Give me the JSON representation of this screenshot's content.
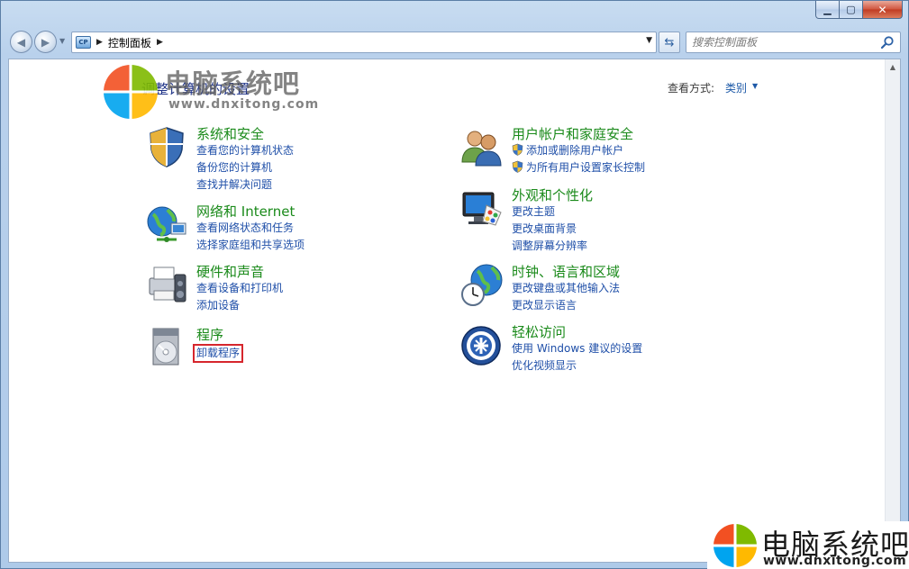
{
  "window": {
    "caption": {
      "minimize": "▁",
      "maximize": "▢",
      "close": "✕"
    }
  },
  "navbar": {
    "address_icon": "CP",
    "address_text": "控制面板",
    "search_placeholder": "搜索控制面板"
  },
  "header": {
    "title": "调整计算机的设置",
    "viewby_label": "查看方式:",
    "viewby_value": "类别"
  },
  "categories": [
    {
      "title": "系统和安全",
      "icon": "shield-icon",
      "links": [
        "查看您的计算机状态",
        "备份您的计算机",
        "查找并解决问题"
      ]
    },
    {
      "title": "网络和 Internet",
      "icon": "network-globe-icon",
      "links": [
        "查看网络状态和任务",
        "选择家庭组和共享选项"
      ]
    },
    {
      "title": "硬件和声音",
      "icon": "printer-speaker-icon",
      "links": [
        "查看设备和打印机",
        "添加设备"
      ]
    },
    {
      "title": "程序",
      "icon": "programs-disc-icon",
      "links": [
        "卸载程序"
      ]
    },
    {
      "title": "用户帐户和家庭安全",
      "icon": "users-icon",
      "links": [
        "添加或删除用户帐户",
        "为所有用户设置家长控制"
      ]
    },
    {
      "title": "外观和个性化",
      "icon": "monitor-palette-icon",
      "links": [
        "更改主题",
        "更改桌面背景",
        "调整屏幕分辨率"
      ]
    },
    {
      "title": "时钟、语言和区域",
      "icon": "clock-globe-icon",
      "links": [
        "更改键盘或其他输入法",
        "更改显示语言"
      ]
    },
    {
      "title": "轻松访问",
      "icon": "ease-of-access-icon",
      "links": [
        "使用 Windows 建议的设置",
        "优化视频显示"
      ]
    }
  ],
  "watermarks": {
    "top_text": "电脑系统吧",
    "top_url": "www.dnxitong.com",
    "bottom_text": "电脑系统吧",
    "bottom_url": "www.dnxitong.com"
  },
  "colors": {
    "category_title": "#1a8a1a",
    "link": "#1f4fa8",
    "highlight_box": "#d6262d",
    "page_title": "#1e3287"
  }
}
